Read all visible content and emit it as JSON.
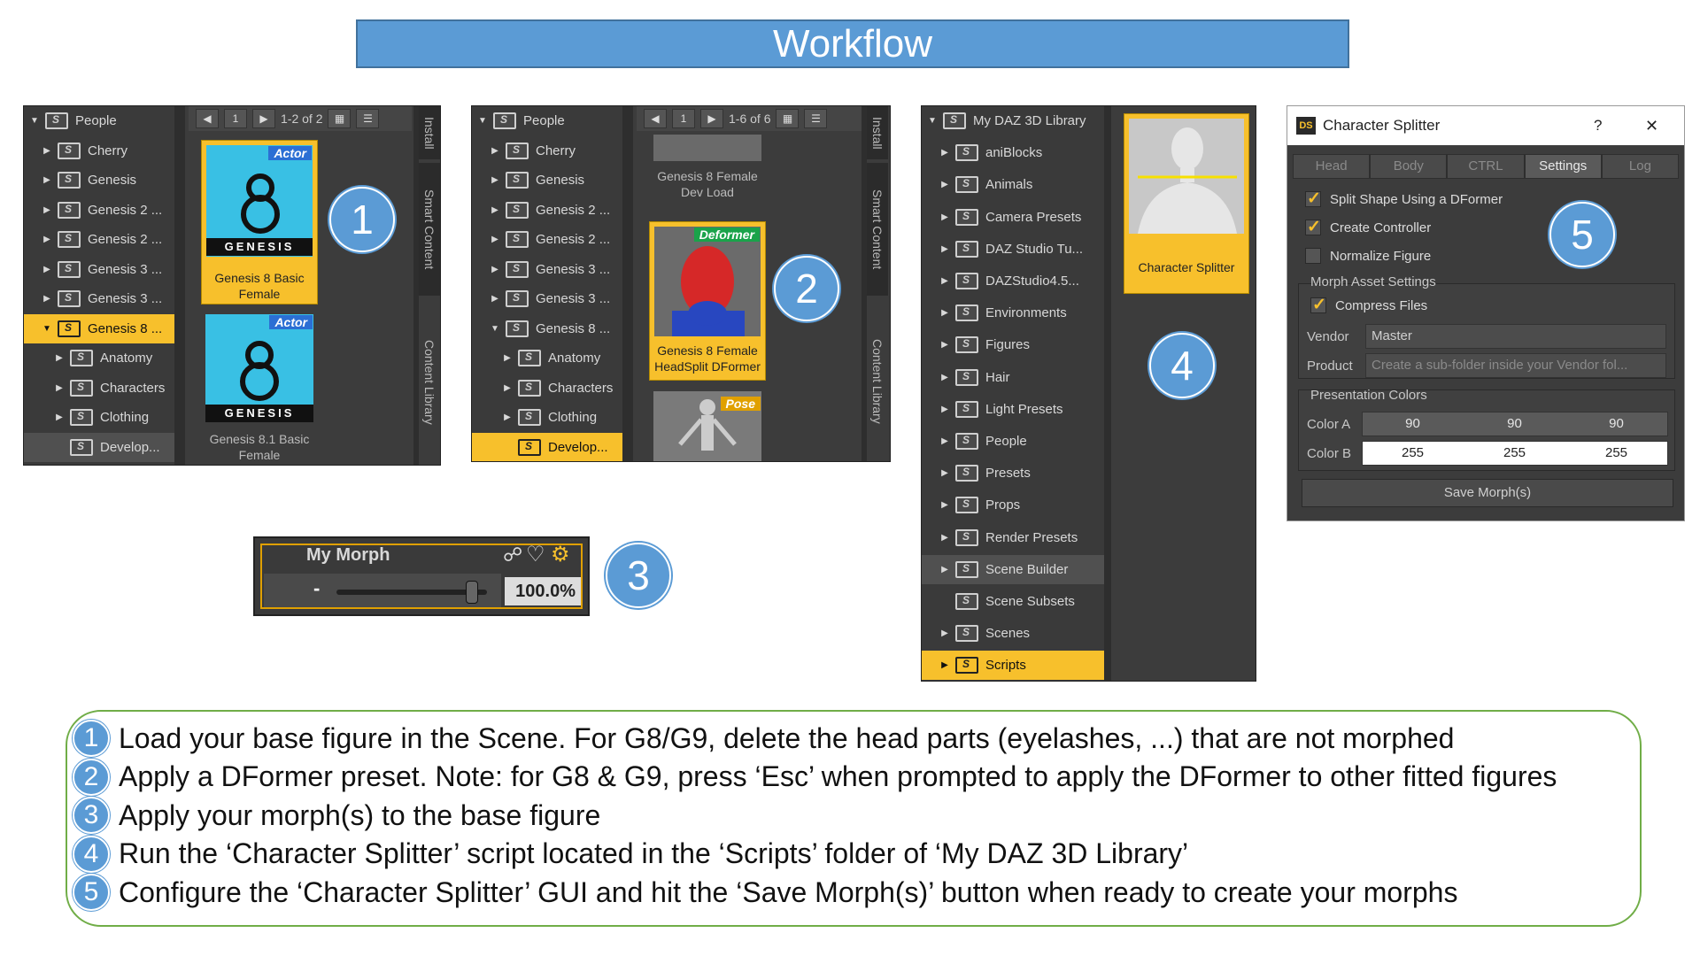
{
  "banner": {
    "title": "Workflow"
  },
  "panel1": {
    "tree": [
      {
        "label": "People",
        "arrow": "▼",
        "indent": 0
      },
      {
        "label": "Cherry",
        "arrow": "▶",
        "indent": 1
      },
      {
        "label": "Genesis",
        "arrow": "▶",
        "indent": 1
      },
      {
        "label": "Genesis 2 ...",
        "arrow": "▶",
        "indent": 1
      },
      {
        "label": "Genesis 2 ...",
        "arrow": "▶",
        "indent": 1
      },
      {
        "label": "Genesis 3 ...",
        "arrow": "▶",
        "indent": 1
      },
      {
        "label": "Genesis 3 ...",
        "arrow": "▶",
        "indent": 1
      },
      {
        "label": "Genesis 8 ...",
        "arrow": "▼",
        "indent": 1,
        "selected": true
      },
      {
        "label": "Anatomy",
        "arrow": "▶",
        "indent": 2
      },
      {
        "label": "Characters",
        "arrow": "▶",
        "indent": 2
      },
      {
        "label": "Clothing",
        "arrow": "▶",
        "indent": 2
      },
      {
        "label": "Develop...",
        "arrow": "",
        "indent": 2,
        "highlight": true
      }
    ],
    "page_num": "1",
    "page_range": "1-2 of 2",
    "items": [
      {
        "badge": "Actor",
        "genesis": "GENESIS",
        "caption": "Genesis 8 Basic Female"
      },
      {
        "badge": "Actor",
        "genesis": "GENESIS",
        "caption": "Genesis 8.1 Basic Female"
      }
    ],
    "tabs": [
      "Install",
      "Smart Content",
      "Content Library"
    ]
  },
  "panel2": {
    "tree": [
      {
        "label": "People",
        "arrow": "▼",
        "indent": 0
      },
      {
        "label": "Cherry",
        "arrow": "▶",
        "indent": 1
      },
      {
        "label": "Genesis",
        "arrow": "▶",
        "indent": 1
      },
      {
        "label": "Genesis 2 ...",
        "arrow": "▶",
        "indent": 1
      },
      {
        "label": "Genesis 2 ...",
        "arrow": "▶",
        "indent": 1
      },
      {
        "label": "Genesis 3 ...",
        "arrow": "▶",
        "indent": 1
      },
      {
        "label": "Genesis 3 ...",
        "arrow": "▶",
        "indent": 1
      },
      {
        "label": "Genesis 8 ...",
        "arrow": "▼",
        "indent": 1
      },
      {
        "label": "Anatomy",
        "arrow": "▶",
        "indent": 2
      },
      {
        "label": "Characters",
        "arrow": "▶",
        "indent": 2
      },
      {
        "label": "Clothing",
        "arrow": "▶",
        "indent": 2
      },
      {
        "label": "Develop...",
        "arrow": "",
        "indent": 2,
        "selected": true
      }
    ],
    "page_num": "1",
    "page_range": "1-6 of 6",
    "items": [
      {
        "caption": "Genesis 8 Female Dev Load"
      },
      {
        "badge": "Deformer",
        "caption": "Genesis 8 Female HeadSplit DFormer"
      },
      {
        "badge": "Pose"
      }
    ],
    "tabs": [
      "Install",
      "Smart Content",
      "Content Library"
    ]
  },
  "morph": {
    "name": "My Morph",
    "minus": "-",
    "value": "100.0%",
    "fraction": 0.9
  },
  "panel4": {
    "tree": [
      {
        "label": "My DAZ 3D Library",
        "arrow": "▼",
        "indent": 0
      },
      {
        "label": "aniBlocks",
        "arrow": "▶",
        "indent": 1
      },
      {
        "label": "Animals",
        "arrow": "▶",
        "indent": 1
      },
      {
        "label": "Camera Presets",
        "arrow": "▶",
        "indent": 1
      },
      {
        "label": "DAZ Studio Tu...",
        "arrow": "▶",
        "indent": 1
      },
      {
        "label": "DAZStudio4.5...",
        "arrow": "▶",
        "indent": 1
      },
      {
        "label": "Environments",
        "arrow": "▶",
        "indent": 1
      },
      {
        "label": "Figures",
        "arrow": "▶",
        "indent": 1
      },
      {
        "label": "Hair",
        "arrow": "▶",
        "indent": 1
      },
      {
        "label": "Light Presets",
        "arrow": "▶",
        "indent": 1
      },
      {
        "label": "People",
        "arrow": "▶",
        "indent": 1
      },
      {
        "label": "Presets",
        "arrow": "▶",
        "indent": 1
      },
      {
        "label": "Props",
        "arrow": "▶",
        "indent": 1
      },
      {
        "label": "Render Presets",
        "arrow": "▶",
        "indent": 1
      },
      {
        "label": "Scene Builder",
        "arrow": "▶",
        "indent": 1,
        "highlight": true
      },
      {
        "label": "Scene Subsets",
        "arrow": "",
        "indent": 1
      },
      {
        "label": "Scenes",
        "arrow": "▶",
        "indent": 1
      },
      {
        "label": "Scripts",
        "arrow": "▶",
        "indent": 1,
        "selected": true
      }
    ],
    "item_caption": "Character Splitter"
  },
  "dialog": {
    "title": "Character Splitter",
    "help": "?",
    "close": "✕",
    "icon_text": "DS",
    "tabs": [
      {
        "label": "Head",
        "active": false
      },
      {
        "label": "Body",
        "active": false
      },
      {
        "label": "CTRL",
        "active": false
      },
      {
        "label": "Settings",
        "active": true
      },
      {
        "label": "Log",
        "active": false
      }
    ],
    "split_shape": {
      "label": "Split Shape Using a DFormer",
      "checked": true
    },
    "create_controller": {
      "label": "Create Controller",
      "checked": true
    },
    "normalize": {
      "label": "Normalize Figure",
      "checked": false
    },
    "asset_group": "Morph Asset Settings",
    "compress": {
      "label": "Compress Files",
      "checked": true
    },
    "vendor_label": "Vendor",
    "vendor_value": "Master",
    "product_label": "Product",
    "product_placeholder": "Create a sub-folder inside your Vendor fol...",
    "colors_group": "Presentation Colors",
    "color_a": {
      "label": "Color A",
      "values": [
        "90",
        "90",
        "90"
      ],
      "hex": "#5a5a5a"
    },
    "color_b": {
      "label": "Color B",
      "values": [
        "255",
        "255",
        "255"
      ],
      "hex": "#ffffff"
    },
    "save_label": "Save Morph(s)"
  },
  "callouts": [
    "1",
    "2",
    "3",
    "4",
    "5"
  ],
  "steps": [
    {
      "num": "1",
      "text": "Load your base figure in the Scene. For G8/G9, delete the head parts (eyelashes, ...) that are not morphed"
    },
    {
      "num": "2",
      "text": "Apply a DFormer preset. Note: for G8 & G9, press ‘Esc’ when prompted to apply the DFormer to other fitted figures"
    },
    {
      "num": "3",
      "text": "Apply your morph(s) to the base figure"
    },
    {
      "num": "4",
      "text": "Run the ‘Character Splitter’ script located in the ‘Scripts’ folder of ‘My DAZ 3D Library’"
    },
    {
      "num": "5",
      "text": "Configure the  ‘Character Splitter’ GUI and hit the ‘Save Morph(s)’ button when ready to create your morphs"
    }
  ],
  "colors": {
    "accent": "#5b9bd5",
    "selection": "#f7c02c",
    "panel": "#3c3c3c",
    "border_green": "#70ad47"
  }
}
